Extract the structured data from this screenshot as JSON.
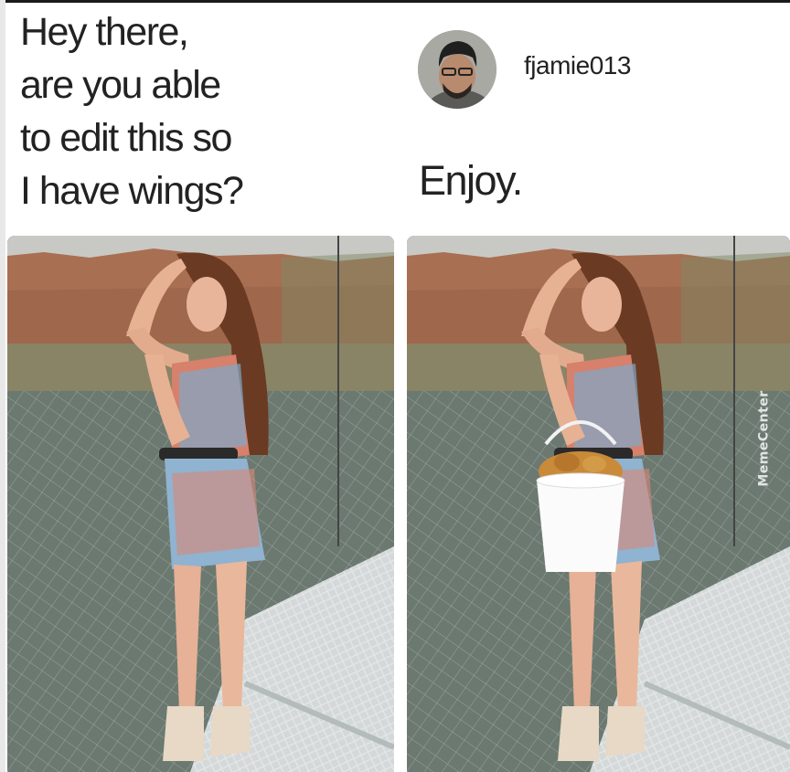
{
  "request": {
    "lines": [
      "Hey there,",
      "are you able",
      "to edit this so",
      "I have wings?"
    ]
  },
  "reply": {
    "username": "fjamie013",
    "text": "Enjoy."
  },
  "images": {
    "left": "original-photo",
    "right": "edited-photo-with-bucket"
  },
  "watermark": "MemeCenter"
}
